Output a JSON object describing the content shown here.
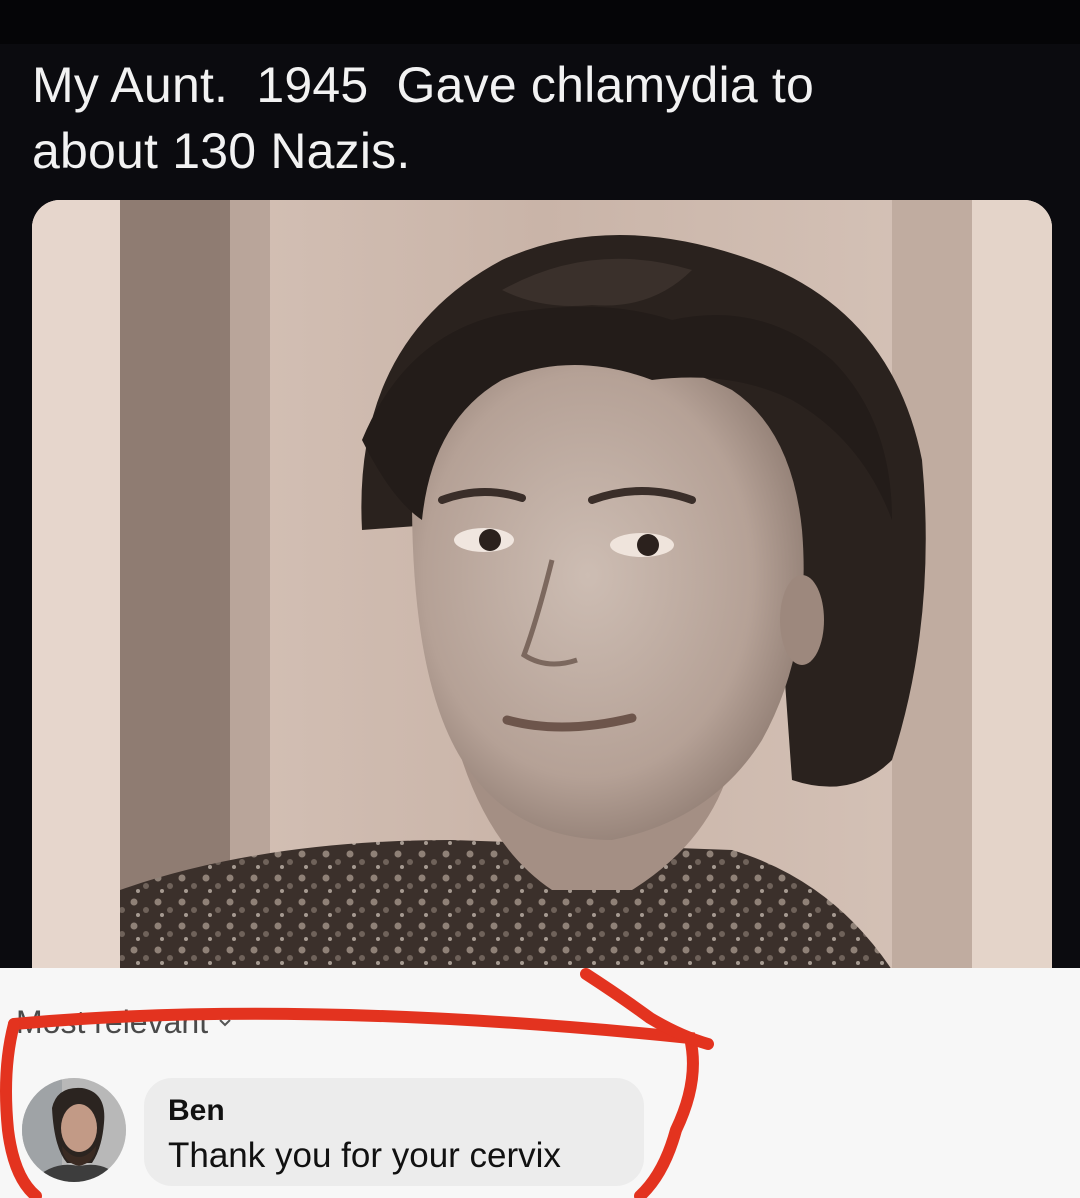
{
  "post": {
    "text": "My Aunt.  1945  Gave chlamydia to\nabout 130 Nazis."
  },
  "comments": {
    "sort_label": "Most relevant",
    "items": [
      {
        "author": "Ben",
        "text": "Thank you for your cervix"
      }
    ]
  },
  "colors": {
    "background": "#0b0b0f",
    "comments_background": "#f7f7f7",
    "highlight": "#e3331f"
  }
}
